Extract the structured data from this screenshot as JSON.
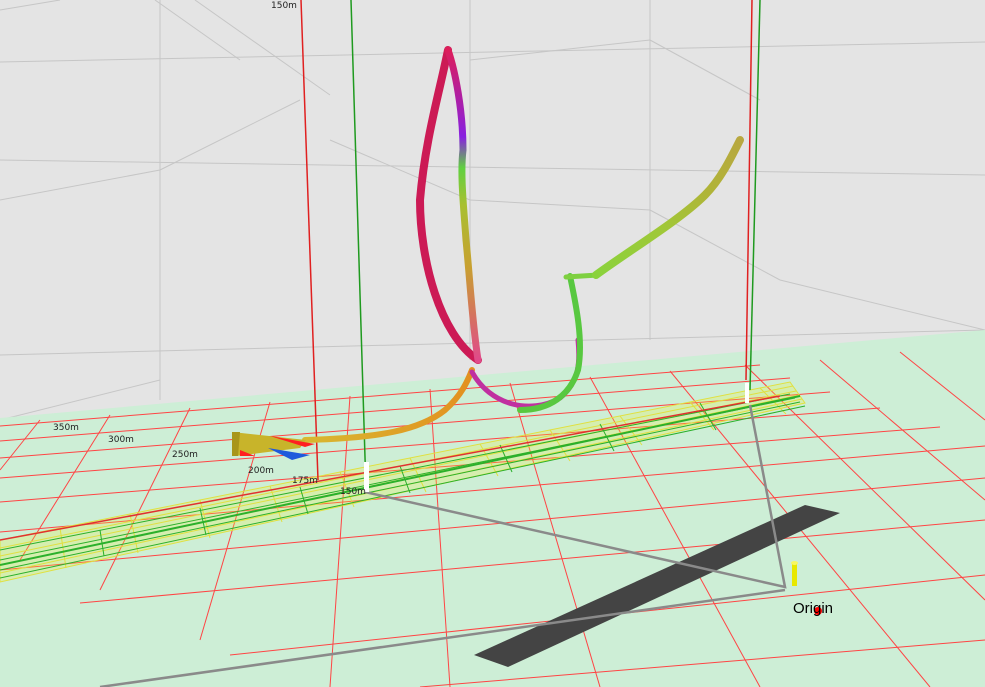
{
  "viewer": {
    "top_altitude_label": "150m",
    "distance_labels": [
      "150m",
      "175m",
      "200m",
      "250m",
      "300m",
      "350m"
    ],
    "origin_label": "Origin",
    "colors": {
      "sky": "#e4e4e4",
      "ground": "#cdeed6",
      "grid_red": "#ff3333",
      "grid_green": "#22aa22",
      "grid_yellow": "#e6e640",
      "runway": "#444444",
      "pilot_line": "#8a8a8a",
      "origin_marker": "#ff0000",
      "origin_pole": "#e8e800"
    },
    "icons": [
      "glider-icon",
      "origin-marker-icon"
    ]
  }
}
